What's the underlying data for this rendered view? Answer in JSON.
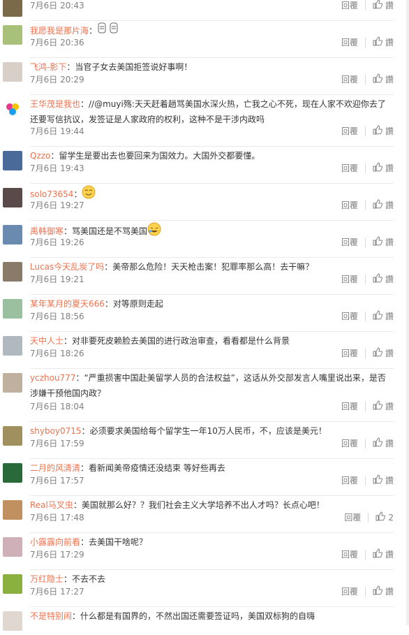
{
  "reply_label": "回覆",
  "like_label": "讚",
  "comments": [
    {
      "name": "",
      "text": "",
      "date": "7月6日 20:43",
      "like": "讚",
      "avatar": "#7a6a4a"
    },
    {
      "name": "我愿我是那片海",
      "text": "：",
      "date": "7月6日 20:36",
      "like": "讚",
      "avatar": "#a8c07a",
      "emoji": "mic"
    },
    {
      "name": "飞鸿-影下",
      "text": "：当官子女去美国拒签说好事啊！",
      "date": "7月6日 20:29",
      "like": "讚",
      "avatar": "#d8d0c8"
    },
    {
      "name": "王华茂是我也",
      "text": "：//@muyi殇:天天赶着趟骂美国水深火热，亡我之心不死，现在人家不欢迎你去了还要写信抗议，发签证是人家政府的权利，这种不是干涉内政吗",
      "date": "7月6日 19:44",
      "like": "讚",
      "avatar": "#ffffff",
      "wrap": true
    },
    {
      "name": "Qzzo",
      "text": "：留学生是要出去也要回来为国效力。大国外交都要懂。",
      "date": "7月6日 19:43",
      "like": "讚",
      "avatar": "#4a6a9a"
    },
    {
      "name": "solo73654",
      "text": "：",
      "date": "7月6日 19:27",
      "like": "讚",
      "avatar": "#5a4a4a",
      "emoji": "smile"
    },
    {
      "name": "禹韩御寒",
      "text": "：骂美国还是不骂美国",
      "date": "7月6日 19:26",
      "like": "讚",
      "avatar": "#6a8ab0",
      "emoji": "laugh"
    },
    {
      "name": "Lucas今天乱炭了吗",
      "text": "：美帝那么危险！天天枪击案！犯罪率那么高！去干嘛？",
      "date": "7月6日 19:21",
      "like": "讚",
      "avatar": "#8a7a6a"
    },
    {
      "name": "某年某月的夏天666",
      "text": "：对等原则走起",
      "date": "7月6日 18:56",
      "like": "讚",
      "avatar": "#9ac0a0"
    },
    {
      "name": "天中人士",
      "text": "：对非要死皮赖脸去美国的进行政治审查，看看都是什么背景",
      "date": "7月6日 18:26",
      "like": "讚",
      "avatar": "#b0b8c0"
    },
    {
      "name": "yczhou777",
      "text": "：“严重损害中国赴美留学人员的合法权益”，这话从外交部发言人嘴里说出来，是否涉嫌干预他国内政？",
      "date": "7月6日 18:04",
      "like": "讚",
      "avatar": "#c0b0a0",
      "wrap": true
    },
    {
      "name": "shyboy0715",
      "text": "：必须要求美国给每个留学生一年10万人民币，不，应该是美元！",
      "date": "7月6日 17:59",
      "like": "讚",
      "avatar": "#a09060"
    },
    {
      "name": "二月的风清清",
      "text": "：看新闻美帝疫情还没结束 等好些再去",
      "date": "7月6日 17:57",
      "like": "讚",
      "avatar": "#2a6a3a"
    },
    {
      "name": "Real马叉虫",
      "text": "：美国就那么好？？我们社会主义大学培养不出人才吗？长点心吧！",
      "date": "7月6日 17:48",
      "like": "2",
      "avatar": "#c09060"
    },
    {
      "name": "小露露向前看",
      "text": "：去美国干啥呢？",
      "date": "7月6日 17:29",
      "like": "讚",
      "avatar": "#d0b0b8"
    },
    {
      "name": "万红隐士",
      "text": "：不去不去",
      "date": "7月6日 17:27",
      "like": "讚",
      "avatar": "#8ab040"
    },
    {
      "name": "不是特别闹",
      "text": "：什么都是有国界的，不然出国还需要签证吗，美国双标狗的自嗨",
      "date": "",
      "like": "",
      "avatar": "#e0d8d0",
      "partial": true
    }
  ]
}
